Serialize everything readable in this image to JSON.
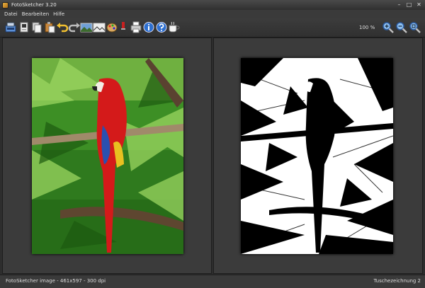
{
  "window": {
    "title": "FotoSketcher 3.20",
    "controls": [
      "–",
      "□",
      "✕"
    ]
  },
  "menu": {
    "items": [
      "Datei",
      "Bearbeiten",
      "Hilfe"
    ]
  },
  "toolbar": {
    "icons": [
      "scanner-icon",
      "open-file-icon",
      "copy-icon",
      "paste-icon",
      "undo-icon",
      "redo-icon",
      "original-image-icon",
      "sketch-image-icon",
      "palette-icon",
      "brush-icon",
      "print-icon",
      "info-icon",
      "help-icon",
      "coffee-icon"
    ],
    "zoom": "100 %",
    "zoom_icons": [
      "zoom-in-icon",
      "zoom-out-icon",
      "zoom-fit-icon"
    ]
  },
  "status": {
    "left": "FotoSketcher image - 461x597 - 300 dpi",
    "right": "Tuschezeichnung 2"
  }
}
